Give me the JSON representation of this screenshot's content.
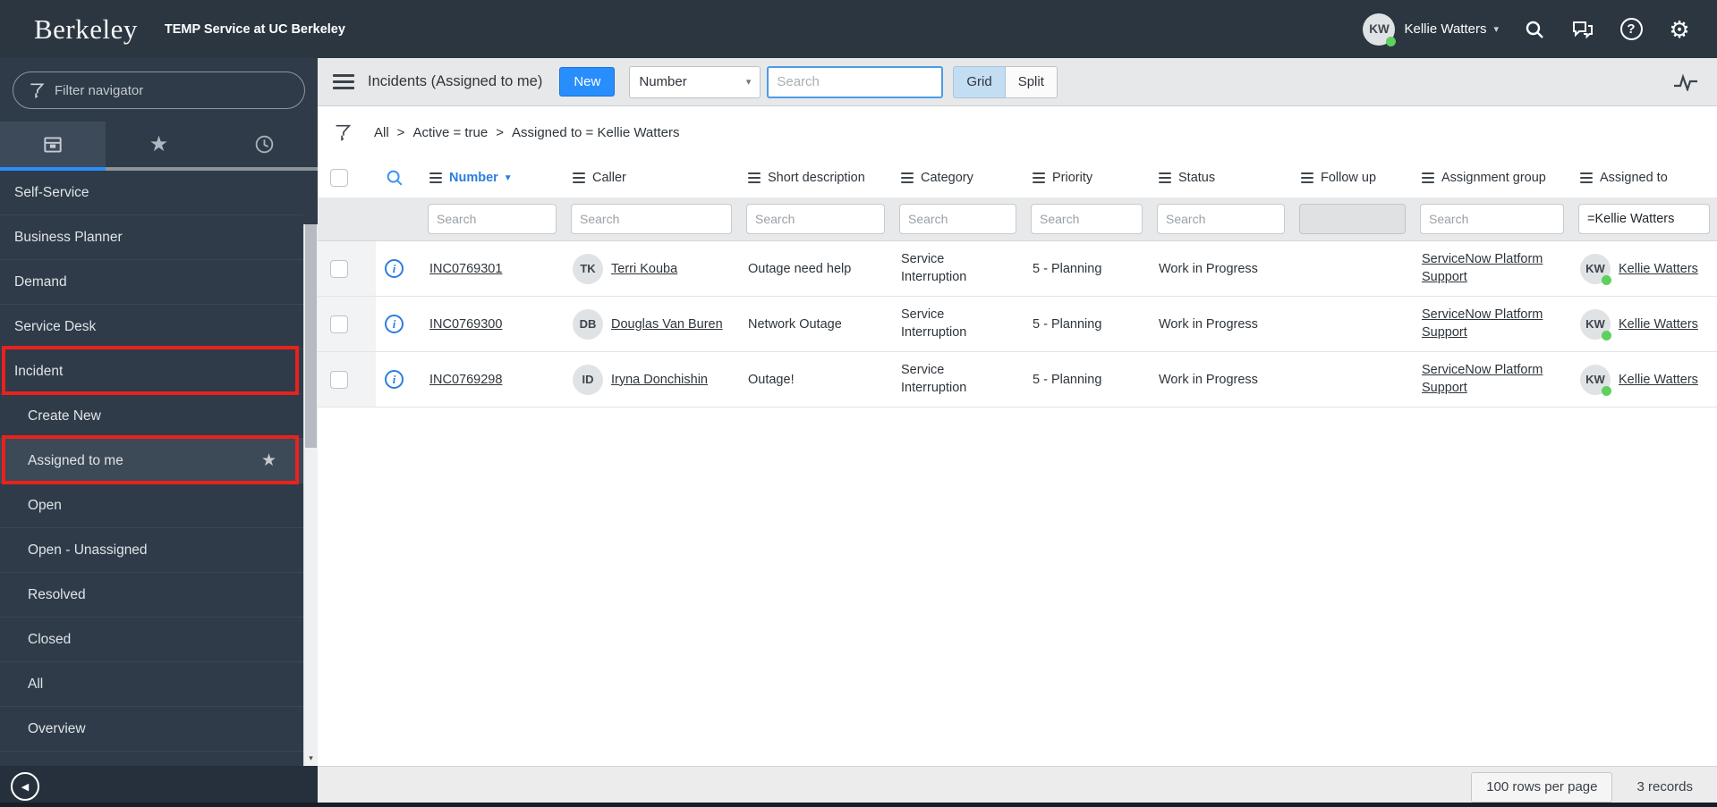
{
  "theme": {
    "accent_blue": "#278efc",
    "annotation_red": "#e8221d",
    "header_bg": "#2b3641",
    "sidebar_bg": "#2f3b48",
    "presence_green": "#5ed05e"
  },
  "header": {
    "logo": "Berkeley",
    "app_title": "TEMP Service at UC Berkeley",
    "user": {
      "initials": "KW",
      "name": "Kellie Watters"
    }
  },
  "sidebar": {
    "filter_placeholder": "Filter navigator",
    "items": [
      {
        "label": "Self-Service"
      },
      {
        "label": "Business Planner"
      },
      {
        "label": "Demand"
      },
      {
        "label": "Service Desk"
      },
      {
        "label": "Incident"
      },
      {
        "label": "Create New"
      },
      {
        "label": "Assigned to me"
      },
      {
        "label": "Open"
      },
      {
        "label": "Open - Unassigned"
      },
      {
        "label": "Resolved"
      },
      {
        "label": "Closed"
      },
      {
        "label": "All"
      },
      {
        "label": "Overview"
      }
    ]
  },
  "toolbar": {
    "title": "Incidents (Assigned to me)",
    "new_button": "New",
    "field_selector": "Number",
    "search_placeholder": "Search",
    "view_grid": "Grid",
    "view_split": "Split"
  },
  "breadcrumb": {
    "separator": ">",
    "segments": [
      "All",
      "Active = true",
      "Assigned to = Kellie Watters"
    ]
  },
  "table": {
    "columns": [
      "Number",
      "Caller",
      "Short description",
      "Category",
      "Priority",
      "Status",
      "Follow up",
      "Assignment group",
      "Assigned to"
    ],
    "filter_placeholder": "Search",
    "assigned_to_filter": "=Kellie Watters",
    "rows": [
      {
        "number": "INC0769301",
        "caller_initials": "TK",
        "caller": "Terri Kouba",
        "short_description": "Outage need help",
        "category": "Service Interruption",
        "priority": "5 - Planning",
        "status": "Work in Progress",
        "follow_up": "",
        "assignment_group": "ServiceNow Platform Support",
        "assigned_initials": "KW",
        "assigned_to": "Kellie Watters"
      },
      {
        "number": "INC0769300",
        "caller_initials": "DB",
        "caller": "Douglas Van Buren",
        "short_description": "Network Outage",
        "category": "Service Interruption",
        "priority": "5 - Planning",
        "status": "Work in Progress",
        "follow_up": "",
        "assignment_group": "ServiceNow Platform Support",
        "assigned_initials": "KW",
        "assigned_to": "Kellie Watters"
      },
      {
        "number": "INC0769298",
        "caller_initials": "ID",
        "caller": "Iryna Donchishin",
        "short_description": "Outage!",
        "category": "Service Interruption",
        "priority": "5 - Planning",
        "status": "Work in Progress",
        "follow_up": "",
        "assignment_group": "ServiceNow Platform Support",
        "assigned_initials": "KW",
        "assigned_to": "Kellie Watters"
      }
    ]
  },
  "footer": {
    "rows_per_page": "100 rows per page",
    "record_count": "3 records"
  }
}
